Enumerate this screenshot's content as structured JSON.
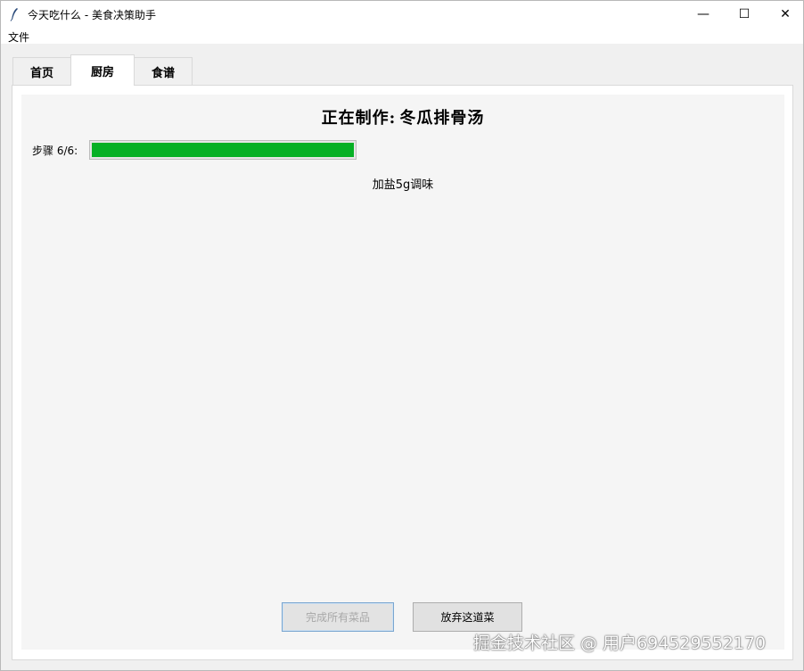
{
  "window": {
    "title": "今天吃什么 - 美食决策助手",
    "controls": {
      "minimize": "—",
      "maximize": "☐",
      "close": "✕"
    }
  },
  "menu": {
    "file": "文件"
  },
  "tabs": [
    {
      "label": "首页",
      "active": false
    },
    {
      "label": "厨房",
      "active": true
    },
    {
      "label": "食谱",
      "active": false
    }
  ],
  "kitchen": {
    "title_prefix": "正在制作:",
    "dish": "冬瓜排骨汤",
    "step_label": "步骤 6/6:",
    "progress_percent": 100,
    "progress_color": "#06b025",
    "step_text": "加盐5g调味",
    "finish_button": "完成所有菜品",
    "finish_button_enabled": false,
    "abandon_button": "放弃这道菜"
  },
  "watermark": "掘金技术社区 @ 用户694529552170"
}
